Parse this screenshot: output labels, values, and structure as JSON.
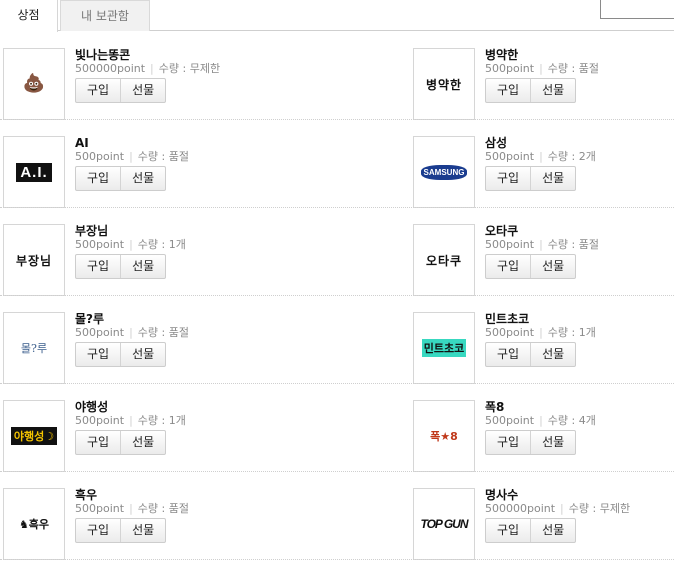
{
  "tabs": [
    {
      "label": "상점",
      "active": true
    },
    {
      "label": "내 보관함",
      "active": false
    }
  ],
  "search": {
    "value": ""
  },
  "buttons": {
    "buy": "구입",
    "gift": "선물"
  },
  "quantity_label": "수량",
  "items": [
    {
      "name": "빛나는똥콘",
      "price": "500000point",
      "qty": "무제한",
      "icon": "poop-icon",
      "thumb_text": "💩",
      "thumb_style": "art-poop"
    },
    {
      "name": "병약한",
      "price": "500point",
      "qty": "품절",
      "icon": "text-logo-icon",
      "thumb_text": "병약한",
      "thumb_style": "art-text"
    },
    {
      "name": "AI",
      "price": "500point",
      "qty": "품절",
      "icon": "ai-logo-icon",
      "thumb_text": "A.I.",
      "thumb_style": "art-ai"
    },
    {
      "name": "삼성",
      "price": "500point",
      "qty": "2개",
      "icon": "samsung-logo-icon",
      "thumb_text": "SAMSUNG",
      "thumb_style": "art-samsung"
    },
    {
      "name": "부장님",
      "price": "500point",
      "qty": "1개",
      "icon": "text-logo-icon",
      "thumb_text": "부장님",
      "thumb_style": "art-text"
    },
    {
      "name": "오타쿠",
      "price": "500point",
      "qty": "품절",
      "icon": "text-logo-icon",
      "thumb_text": "오타쿠",
      "thumb_style": "art-text"
    },
    {
      "name": "몰?루",
      "price": "500point",
      "qty": "품절",
      "icon": "text-logo-icon",
      "thumb_text": "몰?루",
      "thumb_style": "art-mol"
    },
    {
      "name": "민트초코",
      "price": "500point",
      "qty": "1개",
      "icon": "mint-logo-icon",
      "thumb_text": "민트초코",
      "thumb_style": "art-mint"
    },
    {
      "name": "야행성",
      "price": "500point",
      "qty": "1개",
      "icon": "night-logo-icon",
      "thumb_text": "야행성☽",
      "thumb_style": "art-yahaeng"
    },
    {
      "name": "폭8",
      "price": "500point",
      "qty": "4개",
      "icon": "star-logo-icon",
      "thumb_text": "폭★8",
      "thumb_style": "art-pok"
    },
    {
      "name": "흑우",
      "price": "500point",
      "qty": "품절",
      "icon": "cow-logo-icon",
      "thumb_text": "♞흑우",
      "thumb_style": "art-heuk"
    },
    {
      "name": "명사수",
      "price": "500000point",
      "qty": "무제한",
      "icon": "topgun-logo-icon",
      "thumb_text": "TOP GUN",
      "thumb_style": "art-topgun"
    }
  ]
}
